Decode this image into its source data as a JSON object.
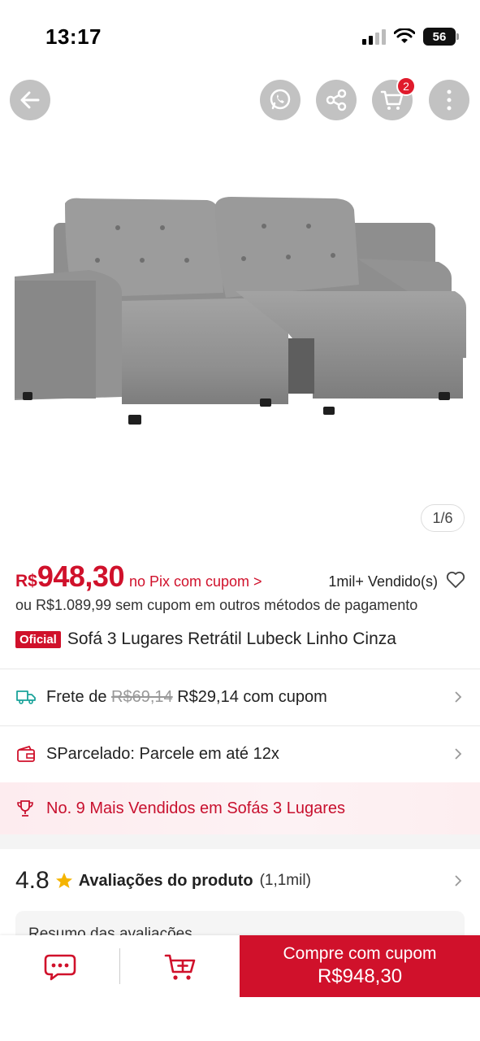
{
  "status_bar": {
    "time": "13:17",
    "battery": "56"
  },
  "header": {
    "cart_count": "2"
  },
  "gallery": {
    "counter": "1/6"
  },
  "price": {
    "currency": "R$",
    "value": "948,30",
    "pix_note": "no Pix com cupom >",
    "sold": "1mil+ Vendido(s)",
    "alt_price": "ou R$1.089,99 sem cupom em outros métodos de pagamento"
  },
  "product": {
    "badge": "Oficial",
    "title": "Sofá 3 Lugares Retrátil Lubeck Linho Cinza"
  },
  "shipping": {
    "prefix": "Frete de",
    "old_price": "R$69,14",
    "new_price": "R$29,14 com cupom"
  },
  "installments": {
    "text": "SParcelado: Parcele em até 12x"
  },
  "ranking": {
    "text": "No. 9 Mais Vendidos em Sofás 3 Lugares"
  },
  "rating": {
    "score": "4.8",
    "label": "Avaliações do produto",
    "count": "(1,1mil)"
  },
  "summary": {
    "title": "Resumo das avaliações"
  },
  "bottom_bar": {
    "buy_line1": "Compre com cupom",
    "buy_line2": "R$948,30"
  },
  "colors": {
    "accent": "#d0112b",
    "shipping_icon": "#1aa39a"
  },
  "icons": [
    "back-arrow-icon",
    "whatsapp-icon",
    "share-icon",
    "cart-icon",
    "more-icon",
    "heart-icon",
    "truck-icon",
    "wallet-icon",
    "trophy-icon",
    "star-icon",
    "chevron-right-icon",
    "chat-icon",
    "add-to-cart-icon"
  ]
}
